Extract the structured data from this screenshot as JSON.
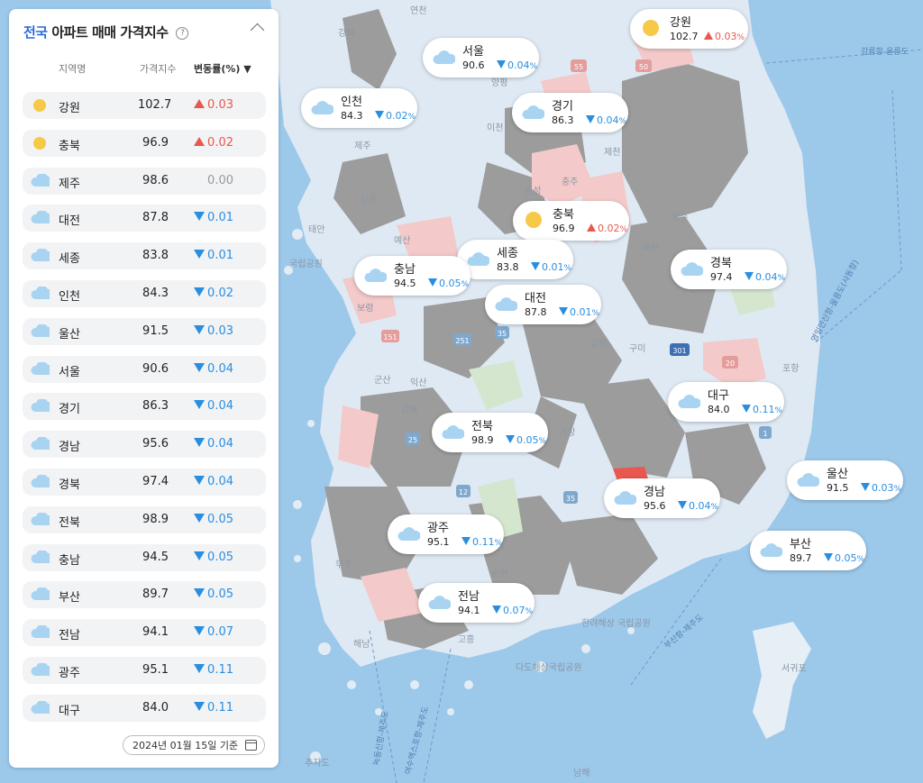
{
  "panel": {
    "title_highlight": "전국",
    "title_rest": "아파트 매매 가격지수",
    "help_glyph": "?",
    "columns": {
      "region": "지역명",
      "index": "가격지수",
      "change": "변동률(%) ▼"
    },
    "rows": [
      {
        "name": "강원",
        "icon": "sun-icon",
        "index": "102.7",
        "change": "0.03",
        "dir": "up"
      },
      {
        "name": "충북",
        "icon": "sun-icon",
        "index": "96.9",
        "change": "0.02",
        "dir": "up"
      },
      {
        "name": "제주",
        "icon": "sun-cloud-icon",
        "index": "98.6",
        "change": "0.00",
        "dir": "flat"
      },
      {
        "name": "대전",
        "icon": "cloud-icon",
        "index": "87.8",
        "change": "0.01",
        "dir": "down"
      },
      {
        "name": "세종",
        "icon": "cloud-icon",
        "index": "83.8",
        "change": "0.01",
        "dir": "down"
      },
      {
        "name": "인천",
        "icon": "cloud-icon",
        "index": "84.3",
        "change": "0.02",
        "dir": "down"
      },
      {
        "name": "울산",
        "icon": "cloud-icon",
        "index": "91.5",
        "change": "0.03",
        "dir": "down"
      },
      {
        "name": "서울",
        "icon": "cloud-icon",
        "index": "90.6",
        "change": "0.04",
        "dir": "down"
      },
      {
        "name": "경기",
        "icon": "cloud-icon",
        "index": "86.3",
        "change": "0.04",
        "dir": "down"
      },
      {
        "name": "경남",
        "icon": "cloud-icon",
        "index": "95.6",
        "change": "0.04",
        "dir": "down"
      },
      {
        "name": "경북",
        "icon": "cloud-icon",
        "index": "97.4",
        "change": "0.04",
        "dir": "down"
      },
      {
        "name": "전북",
        "icon": "cloud-icon",
        "index": "98.9",
        "change": "0.05",
        "dir": "down"
      },
      {
        "name": "충남",
        "icon": "cloud-icon",
        "index": "94.5",
        "change": "0.05",
        "dir": "down"
      },
      {
        "name": "부산",
        "icon": "cloud-icon",
        "index": "89.7",
        "change": "0.05",
        "dir": "down"
      },
      {
        "name": "전남",
        "icon": "cloud-icon",
        "index": "94.1",
        "change": "0.07",
        "dir": "down"
      },
      {
        "name": "광주",
        "icon": "cloud-icon",
        "index": "95.1",
        "change": "0.11",
        "dir": "down"
      },
      {
        "name": "대구",
        "icon": "cloud-icon",
        "index": "84.0",
        "change": "0.11",
        "dir": "down"
      }
    ],
    "date_label": "2024년 01월 15일 기준"
  },
  "map": {
    "callouts": [
      {
        "name": "강원",
        "icon": "sun-icon",
        "index": "102.7",
        "change": "0.03",
        "dir": "up"
      },
      {
        "name": "서울",
        "icon": "cloud-icon",
        "index": "90.6",
        "change": "0.04",
        "dir": "down"
      },
      {
        "name": "인천",
        "icon": "cloud-icon",
        "index": "84.3",
        "change": "0.02",
        "dir": "down"
      },
      {
        "name": "경기",
        "icon": "cloud-icon",
        "index": "86.3",
        "change": "0.04",
        "dir": "down"
      },
      {
        "name": "충북",
        "icon": "sun-icon",
        "index": "96.9",
        "change": "0.02",
        "dir": "up"
      },
      {
        "name": "세종",
        "icon": "cloud-icon",
        "index": "83.8",
        "change": "0.01",
        "dir": "down"
      },
      {
        "name": "충남",
        "icon": "cloud-icon",
        "index": "94.5",
        "change": "0.05",
        "dir": "down"
      },
      {
        "name": "경북",
        "icon": "cloud-icon",
        "index": "97.4",
        "change": "0.04",
        "dir": "down"
      },
      {
        "name": "대전",
        "icon": "cloud-icon",
        "index": "87.8",
        "change": "0.01",
        "dir": "down"
      },
      {
        "name": "대구",
        "icon": "cloud-icon",
        "index": "84.0",
        "change": "0.11",
        "dir": "down"
      },
      {
        "name": "전북",
        "icon": "cloud-icon",
        "index": "98.9",
        "change": "0.05",
        "dir": "down"
      },
      {
        "name": "울산",
        "icon": "cloud-icon",
        "index": "91.5",
        "change": "0.03",
        "dir": "down"
      },
      {
        "name": "경남",
        "icon": "cloud-icon",
        "index": "95.6",
        "change": "0.04",
        "dir": "down"
      },
      {
        "name": "광주",
        "icon": "cloud-icon",
        "index": "95.1",
        "change": "0.11",
        "dir": "down"
      },
      {
        "name": "부산",
        "icon": "cloud-icon",
        "index": "89.7",
        "change": "0.05",
        "dir": "down"
      },
      {
        "name": "전남",
        "icon": "cloud-icon",
        "index": "94.1",
        "change": "0.07",
        "dir": "down"
      }
    ],
    "pct_suffix": "%",
    "place_labels": [
      "강화",
      "연천",
      "양평",
      "이천",
      "음성",
      "제천",
      "충주",
      "영주",
      "예천",
      "당진",
      "예산",
      "태안",
      "국립공원",
      "보령",
      "김천",
      "구미",
      "군산",
      "익산",
      "김제",
      "거창",
      "무주",
      "순천",
      "해남",
      "고흥",
      "다도해상국립공원",
      "한려해상 국립공원",
      "추자도",
      "남해",
      "서귀포",
      "포항",
      "제주"
    ],
    "route_labels": [
      "강릉항-울릉도",
      "영일만신항-울릉도(사동항)",
      "부산항-제주도",
      "녹동신항-제주도",
      "여수엑스포항-제주도"
    ],
    "road_shields": [
      "55",
      "50",
      "151",
      "251",
      "35",
      "25",
      "12",
      "35",
      "301",
      "20",
      "1"
    ],
    "colors": {
      "sea": "#9cc8ea",
      "land_light": "#dce9f4",
      "land_gray": "#9a9a9a",
      "land_pink": "#f2c7c7",
      "up": "#e8584f",
      "down": "#2a8ee0",
      "sun": "#f7c948",
      "cloud": "#a8d4f2"
    }
  }
}
